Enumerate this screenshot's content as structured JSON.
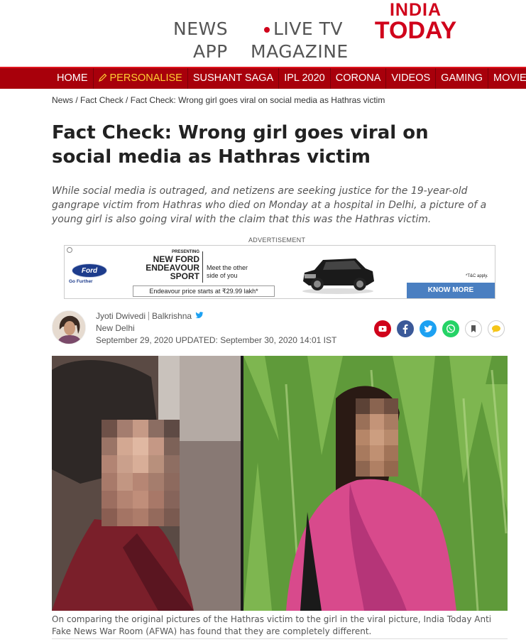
{
  "header": {
    "links": {
      "news": "NEWS",
      "live_tv": "LIVE TV",
      "app": "APP",
      "magazine": "MAGAZINE"
    },
    "logo_line1": "INDIA",
    "logo_line2": "TODAY"
  },
  "nav": {
    "items": [
      {
        "label": "HOME"
      },
      {
        "label": "PERSONALISE",
        "icon": "pencil-icon"
      },
      {
        "label": "SUSHANT SAGA"
      },
      {
        "label": "IPL 2020"
      },
      {
        "label": "CORONA"
      },
      {
        "label": "VIDEOS"
      },
      {
        "label": "GAMING"
      },
      {
        "label": "MOVIES"
      }
    ]
  },
  "breadcrumb": {
    "items": [
      "News",
      "Fact Check",
      "Fact Check: Wrong girl goes viral on social media as Hathras victim"
    ],
    "separator": " / "
  },
  "article": {
    "headline": "Fact Check: Wrong girl goes viral on social media as Hathras victim",
    "summary": "While social media is outraged, and netizens are seeking justice for the 19-year-old gangrape victim from Hathras who died on Monday at a hospital in Delhi, a picture of a young girl is also going viral with the claim that this was the Hathras victim.",
    "authors": [
      "Jyoti Dwivedi",
      "Balkrishna"
    ],
    "location": "New Delhi",
    "dateline": "September 29, 2020 UPDATED: September 30, 2020 14:01 IST",
    "caption": "On comparing the original pictures of the Hathras victim to the girl in the viral picture, India Today Anti Fake News War Room (AFWA) has found that they are completely different."
  },
  "ad": {
    "label": "ADVERTISEMENT",
    "brand": "Ford",
    "brand_tagline": "Go Further",
    "presenting": "PRESENTING",
    "model_line1": "NEW FORD",
    "model_line2": "ENDEAVOUR",
    "model_line3": "SPORT",
    "meet_line1": "Meet the other",
    "meet_line2": "side of you",
    "price": "Endeavour price starts at ₹29.99 lakh*",
    "tc": "*T&C apply.",
    "cta": "KNOW MORE"
  },
  "share": {
    "icons": [
      "youtube-icon",
      "facebook-icon",
      "twitter-icon",
      "whatsapp-icon",
      "bookmark-icon",
      "comment-icon"
    ]
  },
  "colors": {
    "brand_red": "#d0021b",
    "nav_bg": "#a8000b",
    "personalise": "#ffcf33",
    "cta_blue": "#4a7fc1"
  }
}
